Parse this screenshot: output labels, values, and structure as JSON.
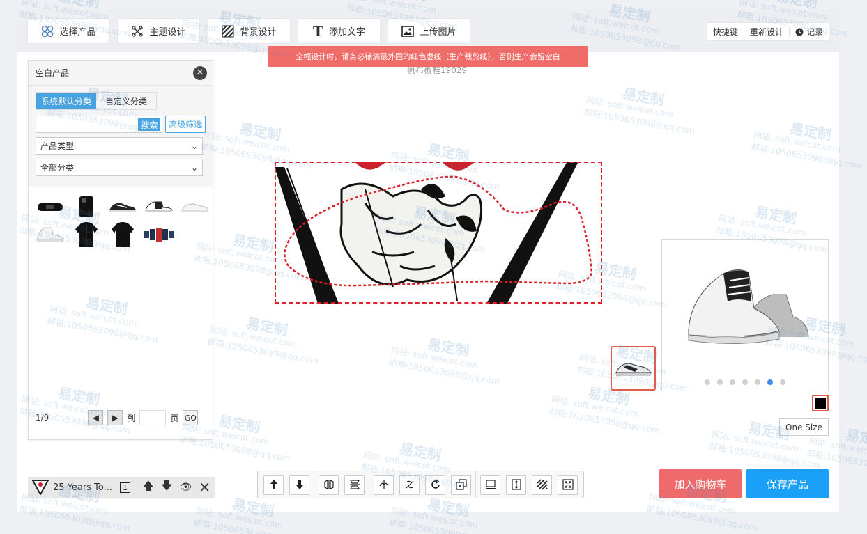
{
  "toolbar": {
    "select_product": "选择产品",
    "theme_design": "主题设计",
    "background_design": "背景设计",
    "add_text": "添加文字",
    "upload_image": "上传图片"
  },
  "right_tools": {
    "shortcuts": "快捷键",
    "redesign": "重新设计",
    "history": "记录"
  },
  "warning": "全幅设计时，请务必铺满最外围的红色虚线（生产裁剪线），否则生产会留空白",
  "design_name": "帆布板鞋19029",
  "panel": {
    "title": "空白产品",
    "tab_default": "系统默认分类",
    "tab_custom": "自定义分类",
    "search_placeholder": "",
    "search_button": "搜索",
    "advanced_filter": "高级筛选",
    "product_type": "产品类型",
    "all_categories": "全部分类",
    "pager": {
      "current": "1/9",
      "goto_label": "到",
      "page_label": "页",
      "go_button": "GO"
    }
  },
  "layer": {
    "name": "25 Years To...",
    "index": "1"
  },
  "preview": {
    "size_label": "One Size",
    "swatch_color": "#000000",
    "active_dot": 6,
    "dot_count": 7
  },
  "actions": {
    "add_to_cart": "加入购物车",
    "save_product": "保存产品"
  },
  "watermark": {
    "title": "易定制",
    "site": "网站: soft.weicot.com",
    "email": "邮箱:1050653098@qq.com"
  },
  "colors": {
    "accent": "#48a3e0",
    "warning": "#ef6c68",
    "cart": "#ef6a6a",
    "save": "#1aa0f6",
    "cut_line": "#e0202a"
  }
}
